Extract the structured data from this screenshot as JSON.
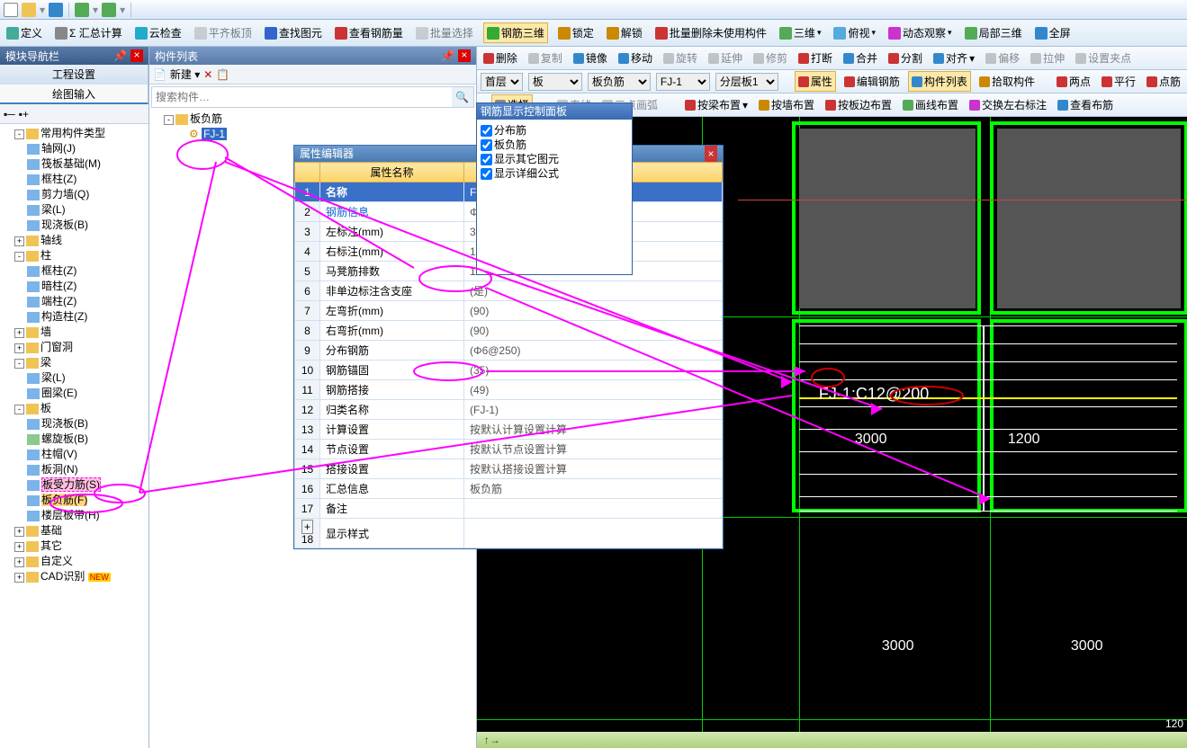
{
  "topbar": {
    "items": [
      "new",
      "open",
      "save",
      "undo",
      "redo"
    ]
  },
  "ribbon": [
    {
      "label": "定义",
      "name": "define",
      "ico": "#4a9"
    },
    {
      "label": "Σ 汇总计算",
      "name": "sum-calc",
      "ico": "#888"
    },
    {
      "label": "云检查",
      "name": "cloud-check",
      "ico": "#2ac"
    },
    {
      "label": "平齐板顶",
      "name": "align-slab",
      "ico": "#aaa",
      "dim": true
    },
    {
      "label": "查找图元",
      "name": "find-elem",
      "ico": "#36c"
    },
    {
      "label": "查看钢筋量",
      "name": "view-rebar",
      "ico": "#c33"
    },
    {
      "label": "批量选择",
      "name": "batch-sel",
      "ico": "#aaa",
      "dim": true
    },
    {
      "label": "钢筋三维",
      "name": "rebar-3d",
      "ico": "#3a3",
      "hl": true
    },
    {
      "label": "锁定",
      "name": "lock",
      "ico": "#c80"
    },
    {
      "label": "解锁",
      "name": "unlock",
      "ico": "#c80"
    },
    {
      "label": "批量删除未使用构件",
      "name": "batch-del",
      "ico": "#c33"
    },
    {
      "label": "三维",
      "name": "3d",
      "ico": "#5a5",
      "dd": true
    },
    {
      "label": "俯视",
      "name": "top-view",
      "ico": "#5ad",
      "dd": true
    },
    {
      "label": "动态观察",
      "name": "orbit",
      "ico": "#c3c",
      "dd": true
    },
    {
      "label": "局部三维",
      "name": "local-3d",
      "ico": "#5a5"
    },
    {
      "label": "全屏",
      "name": "fullscreen",
      "ico": "#38c"
    }
  ],
  "leftpanel": {
    "title": "模块导航栏",
    "tabs": {
      "settings": "工程设置",
      "draw": "绘图输入"
    }
  },
  "tree": [
    {
      "l": "常用构件类型",
      "exp": "-",
      "children": [
        {
          "l": "轴网(J)",
          "c": "b"
        },
        {
          "l": "筏板基础(M)",
          "c": "b"
        },
        {
          "l": "框柱(Z)",
          "c": "b"
        },
        {
          "l": "剪力墙(Q)",
          "c": "b"
        },
        {
          "l": "梁(L)",
          "c": "b"
        },
        {
          "l": "现浇板(B)",
          "c": "b"
        }
      ]
    },
    {
      "l": "轴线",
      "exp": "+"
    },
    {
      "l": "柱",
      "exp": "-",
      "children": [
        {
          "l": "框柱(Z)",
          "c": "b"
        },
        {
          "l": "暗柱(Z)",
          "c": "b"
        },
        {
          "l": "端柱(Z)",
          "c": "b"
        },
        {
          "l": "构造柱(Z)",
          "c": "b"
        }
      ]
    },
    {
      "l": "墙",
      "exp": "+"
    },
    {
      "l": "门窗洞",
      "exp": "+"
    },
    {
      "l": "梁",
      "exp": "-",
      "children": [
        {
          "l": "梁(L)",
          "c": "b"
        },
        {
          "l": "圈梁(E)",
          "c": "b"
        }
      ]
    },
    {
      "l": "板",
      "exp": "-",
      "children": [
        {
          "l": "现浇板(B)",
          "c": "b"
        },
        {
          "l": "螺旋板(B)",
          "c": "g"
        },
        {
          "l": "柱帽(V)",
          "c": "b"
        },
        {
          "l": "板洞(N)",
          "c": "b"
        },
        {
          "l": "板受力筋(S)",
          "c": "b",
          "hl": true
        },
        {
          "l": "板负筋(F)",
          "c": "b",
          "sel": true
        },
        {
          "l": "楼层板带(H)",
          "c": "b"
        }
      ]
    },
    {
      "l": "基础",
      "exp": "+"
    },
    {
      "l": "其它",
      "exp": "+"
    },
    {
      "l": "自定义",
      "exp": "+"
    },
    {
      "l": "CAD识别",
      "exp": "+",
      "new": true
    }
  ],
  "complist": {
    "title": "构件列表",
    "newbtn": "新建",
    "search_ph": "搜索构件…",
    "root": "板负筋",
    "item": "FJ-1"
  },
  "proped": {
    "title": "属性编辑器",
    "col": "属性名称",
    "rows": [
      {
        "n": "1",
        "name": "名称",
        "val": "FJ-1",
        "h": true
      },
      {
        "n": "2",
        "name": "钢筋信息",
        "val": "Φ12@200",
        "blue": true,
        "circ": true
      },
      {
        "n": "3",
        "name": "左标注(mm)",
        "val": "3000",
        "circ2": true
      },
      {
        "n": "4",
        "name": "右标注(mm)",
        "val": "1200",
        "circ2": true
      },
      {
        "n": "5",
        "name": "马凳筋排数",
        "val": "1/1"
      },
      {
        "n": "6",
        "name": "非单边标注含支座",
        "val": "(是)"
      },
      {
        "n": "7",
        "name": "左弯折(mm)",
        "val": "(90)"
      },
      {
        "n": "8",
        "name": "右弯折(mm)",
        "val": "(90)"
      },
      {
        "n": "9",
        "name": "分布钢筋",
        "val": "(Φ6@250)",
        "circ": true
      },
      {
        "n": "10",
        "name": "钢筋锚固",
        "val": "(35)"
      },
      {
        "n": "11",
        "name": "钢筋搭接",
        "val": "(49)"
      },
      {
        "n": "12",
        "name": "归类名称",
        "val": "(FJ-1)"
      },
      {
        "n": "13",
        "name": "计算设置",
        "val": "按默认计算设置计算"
      },
      {
        "n": "14",
        "name": "节点设置",
        "val": "按默认节点设置计算"
      },
      {
        "n": "15",
        "name": "搭接设置",
        "val": "按默认搭接设置计算"
      },
      {
        "n": "16",
        "name": "汇总信息",
        "val": "板负筋"
      },
      {
        "n": "17",
        "name": "备注",
        "val": ""
      },
      {
        "n": "18",
        "name": "显示样式",
        "val": "",
        "exp": "+"
      }
    ]
  },
  "rdpanel": {
    "title": "钢筋显示控制面板",
    "opts": [
      "分布筋",
      "板负筋",
      "显示其它图元",
      "显示详细公式"
    ]
  },
  "toolbar2a": [
    {
      "l": "删除",
      "n": "delete",
      "ico": "#c33"
    },
    {
      "l": "复制",
      "n": "copy",
      "dim": true
    },
    {
      "l": "镜像",
      "n": "mirror",
      "ico": "#38c"
    },
    {
      "l": "移动",
      "n": "move",
      "ico": "#38c"
    },
    {
      "l": "旋转",
      "n": "rotate",
      "dim": true
    },
    {
      "l": "延伸",
      "n": "extend",
      "dim": true
    },
    {
      "l": "修剪",
      "n": "trim",
      "dim": true
    },
    {
      "l": "打断",
      "n": "break",
      "ico": "#c33"
    },
    {
      "l": "合并",
      "n": "merge",
      "ico": "#38c"
    },
    {
      "l": "分割",
      "n": "split",
      "ico": "#c33"
    },
    {
      "l": "对齐",
      "n": "align",
      "ico": "#38c",
      "dd": true
    },
    {
      "l": "偏移",
      "n": "offset",
      "dim": true
    },
    {
      "l": "拉伸",
      "n": "stretch",
      "dim": true
    },
    {
      "l": "设置夹点",
      "n": "grip",
      "dim": true
    }
  ],
  "selrow": {
    "floor": "首层",
    "cat": "板",
    "type": "板负筋",
    "member": "FJ-1",
    "layer": "分层板1",
    "props": "属性",
    "editrebar": "编辑钢筋",
    "complist": "构件列表",
    "pick": "拾取构件",
    "twopoint": "两点",
    "parallel": "平行",
    "dotrebar": "点筋"
  },
  "toolbar2c": [
    {
      "l": "选择",
      "n": "select",
      "sel": true
    },
    {
      "l": "直线",
      "n": "line",
      "dim": true
    },
    {
      "l": "三点画弧",
      "n": "arc3",
      "dim": true
    },
    {
      "l": "按梁布置",
      "n": "by-beam",
      "ico": "#c33",
      "dd": true
    },
    {
      "l": "按墙布置",
      "n": "by-wall",
      "ico": "#c80"
    },
    {
      "l": "按板边布置",
      "n": "by-slab",
      "ico": "#c33"
    },
    {
      "l": "画线布置",
      "n": "by-line",
      "ico": "#5a5"
    },
    {
      "l": "交换左右标注",
      "n": "swap",
      "ico": "#c3c"
    },
    {
      "l": "查看布筋",
      "n": "view-layout",
      "ico": "#38c"
    }
  ],
  "canvas": {
    "label_main": "FJ-1:C12@200",
    "dim_left": "3000",
    "dim_right": "1200",
    "dim_bl": "3000",
    "dim_br": "3000",
    "coord": "120"
  }
}
